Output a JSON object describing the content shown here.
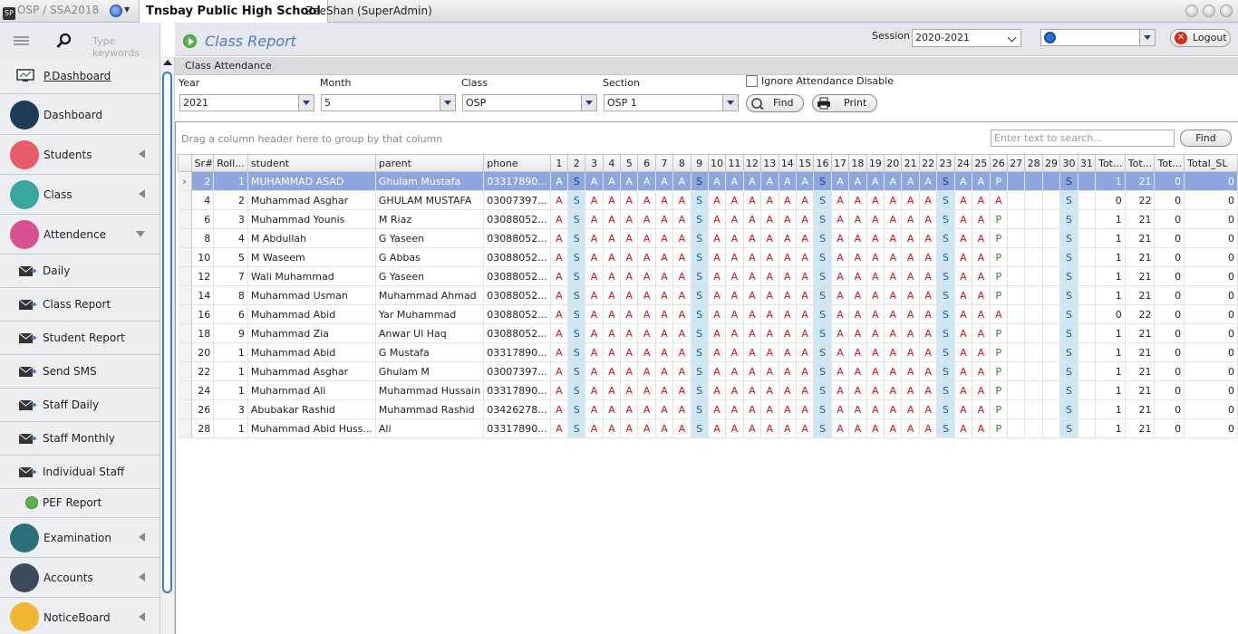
{
  "titlebar": {
    "app": "OSP / SSA2018",
    "school": "Tnsbay Public High School",
    "user": "ZeeShan (SuperAdmin)"
  },
  "sidebar": {
    "search_placeholder": "Type keywords",
    "items": [
      {
        "label": "P.Dashboard"
      },
      {
        "label": "Dashboard"
      },
      {
        "label": "Students"
      },
      {
        "label": "Class"
      },
      {
        "label": "Attendence"
      },
      {
        "label": "Daily"
      },
      {
        "label": "Class Report"
      },
      {
        "label": "Student Report"
      },
      {
        "label": "Send SMS"
      },
      {
        "label": "Staff Daily"
      },
      {
        "label": "Staff Monthly"
      },
      {
        "label": "Individual Staff"
      },
      {
        "label": "PEF Report"
      },
      {
        "label": "Examination"
      },
      {
        "label": "Accounts"
      },
      {
        "label": "NoticeBoard"
      }
    ]
  },
  "header": {
    "title": "Class Report",
    "session_label": "Session :",
    "session_value": "2020-2021",
    "logout_label": "Logout"
  },
  "section_title": "Class Attendance",
  "filters": {
    "year_label": "Year",
    "year_value": "2021",
    "month_label": "Month",
    "month_value": "5",
    "class_label": "Class",
    "class_value": "OSP",
    "section_label": "Section",
    "section_value": "OSP 1",
    "ignore_label": "Ignore Attendance Disable",
    "find_label": "Find",
    "print_label": "Print"
  },
  "grid": {
    "group_hint": "Drag a column header here to group by that column",
    "search_placeholder": "Enter text to search...",
    "find_label": "Find",
    "columns": [
      "Sr#",
      "Roll...",
      "student",
      "parent",
      "phone",
      "1",
      "2",
      "3",
      "4",
      "5",
      "6",
      "7",
      "8",
      "9",
      "10",
      "11",
      "12",
      "13",
      "14",
      "15",
      "16",
      "17",
      "18",
      "19",
      "20",
      "21",
      "22",
      "23",
      "24",
      "25",
      "26",
      "27",
      "28",
      "29",
      "30",
      "31",
      "Tot...",
      "Tot...",
      "Tot...",
      "Total_SL"
    ],
    "rows": [
      {
        "sr": "2",
        "roll": "1",
        "student": "MUHAMMAD ASAD",
        "parent": "Ghulam Mustafa",
        "phone": "03317890...",
        "day26": "P",
        "t1": "1",
        "t2": "21",
        "t3": "0",
        "tsl": "0"
      },
      {
        "sr": "4",
        "roll": "2",
        "student": "Muhammad Asghar",
        "parent": "GHULAM MUSTAFA",
        "phone": "03007397...",
        "day26": "A",
        "t1": "0",
        "t2": "22",
        "t3": "0",
        "tsl": "0"
      },
      {
        "sr": "6",
        "roll": "3",
        "student": "Muhammad Younis",
        "parent": "M Riaz",
        "phone": "03088052...",
        "day26": "P",
        "t1": "1",
        "t2": "21",
        "t3": "0",
        "tsl": "0"
      },
      {
        "sr": "8",
        "roll": "4",
        "student": "M Abdullah",
        "parent": "G Yaseen",
        "phone": "03088052...",
        "day26": "P",
        "t1": "1",
        "t2": "21",
        "t3": "0",
        "tsl": "0"
      },
      {
        "sr": "10",
        "roll": "5",
        "student": "M Waseem",
        "parent": "G Abbas",
        "phone": "03088052...",
        "day26": "P",
        "t1": "1",
        "t2": "21",
        "t3": "0",
        "tsl": "0"
      },
      {
        "sr": "12",
        "roll": "7",
        "student": "Wali Muhammad",
        "parent": "G Yaseen",
        "phone": "03088052...",
        "day26": "P",
        "t1": "1",
        "t2": "21",
        "t3": "0",
        "tsl": "0"
      },
      {
        "sr": "14",
        "roll": "8",
        "student": "Muhammad Usman",
        "parent": "Muhammad Ahmad",
        "phone": "03088052...",
        "day26": "P",
        "t1": "1",
        "t2": "21",
        "t3": "0",
        "tsl": "0"
      },
      {
        "sr": "16",
        "roll": "6",
        "student": "Muhammad Abid",
        "parent": "Yar Muhammad",
        "phone": "03088052...",
        "day26": "A",
        "t1": "0",
        "t2": "22",
        "t3": "0",
        "tsl": "0"
      },
      {
        "sr": "18",
        "roll": "9",
        "student": "Muhammad Zia",
        "parent": "Anwar Ul Haq",
        "phone": "03088052...",
        "day26": "P",
        "t1": "1",
        "t2": "21",
        "t3": "0",
        "tsl": "0"
      },
      {
        "sr": "20",
        "roll": "1",
        "student": "Muhammad Abid",
        "parent": "G Mustafa",
        "phone": "03317890...",
        "day26": "P",
        "t1": "1",
        "t2": "21",
        "t3": "0",
        "tsl": "0"
      },
      {
        "sr": "22",
        "roll": "1",
        "student": "Muhammad Asghar",
        "parent": "Ghulam M",
        "phone": "03007397...",
        "day26": "P",
        "t1": "1",
        "t2": "21",
        "t3": "0",
        "tsl": "0"
      },
      {
        "sr": "24",
        "roll": "1",
        "student": "Muhammad Ali",
        "parent": "Muhammad Hussain",
        "phone": "03317890...",
        "day26": "P",
        "t1": "1",
        "t2": "21",
        "t3": "0",
        "tsl": "0"
      },
      {
        "sr": "26",
        "roll": "3",
        "student": "Abubakar Rashid",
        "parent": "Muhammad Rashid",
        "phone": "03426278...",
        "day26": "P",
        "t1": "1",
        "t2": "21",
        "t3": "0",
        "tsl": "0"
      },
      {
        "sr": "28",
        "roll": "1",
        "student": "Muhammad Abid Huss...",
        "parent": "Ali",
        "phone": "03317890...",
        "day26": "P",
        "t1": "1",
        "t2": "21",
        "t3": "0",
        "tsl": "0"
      }
    ],
    "day_pattern": [
      "A",
      "S",
      "A",
      "A",
      "A",
      "A",
      "A",
      "A",
      "S",
      "A",
      "A",
      "A",
      "A",
      "A",
      "A",
      "S",
      "A",
      "A",
      "A",
      "A",
      "A",
      "A",
      "S",
      "A",
      "A",
      "",
      "",
      "",
      "",
      "S",
      ""
    ],
    "selected_row": 0
  },
  "colors": {
    "accent": "#4a7fc1",
    "selected_row": "#8ea6de",
    "sunday_cell": "#cfe7f3",
    "absent": "#d01010",
    "present": "#2a8a2a"
  }
}
